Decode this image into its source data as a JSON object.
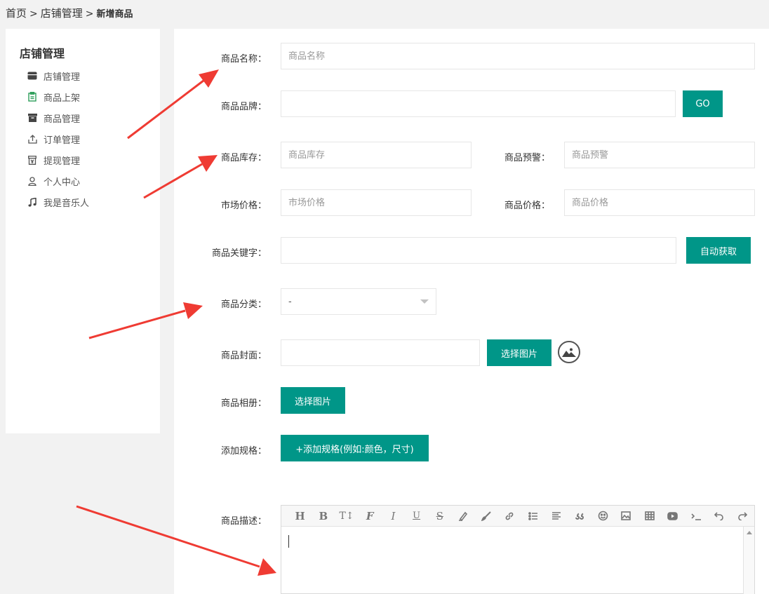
{
  "breadcrumb": {
    "home": "首页",
    "shop": "店铺管理",
    "current": "新增商品",
    "sep": ">"
  },
  "sidebar": {
    "title": "店铺管理",
    "items": [
      {
        "label": "店铺管理",
        "icon": "store-icon"
      },
      {
        "label": "商品上架",
        "icon": "clipboard-icon"
      },
      {
        "label": "商品管理",
        "icon": "archive-icon"
      },
      {
        "label": "订单管理",
        "icon": "upload-icon"
      },
      {
        "label": "提现管理",
        "icon": "wallet-icon"
      },
      {
        "label": "个人中心",
        "icon": "user-icon"
      },
      {
        "label": "我是音乐人",
        "icon": "music-icon"
      }
    ]
  },
  "form": {
    "name": {
      "label": "商品名称：",
      "placeholder": "商品名称"
    },
    "brand": {
      "label": "商品品牌：",
      "button": "GO"
    },
    "stock": {
      "label": "商品库存：",
      "placeholder": "商品库存"
    },
    "warning": {
      "label": "商品预警：",
      "placeholder": "商品预警"
    },
    "market_price": {
      "label": "市场价格：",
      "placeholder": "市场价格"
    },
    "price": {
      "label": "商品价格：",
      "placeholder": "商品价格"
    },
    "keywords": {
      "label": "商品关键字：",
      "button": "自动获取"
    },
    "category": {
      "label": "商品分类：",
      "value": "-"
    },
    "cover": {
      "label": "商品封面：",
      "button": "选择图片"
    },
    "album": {
      "label": "商品相册：",
      "button": "选择图片"
    },
    "spec": {
      "label": "添加规格：",
      "button": "+添加规格(例如:颜色，尺寸)"
    },
    "description": {
      "label": "商品描述："
    }
  },
  "editor_toolbar": [
    "H",
    "B",
    "T↕",
    "F",
    "I",
    "U",
    "S"
  ],
  "colors": {
    "accent": "#009688",
    "arrow": "#ef3b33",
    "active_icon": "#2e9e5a"
  }
}
